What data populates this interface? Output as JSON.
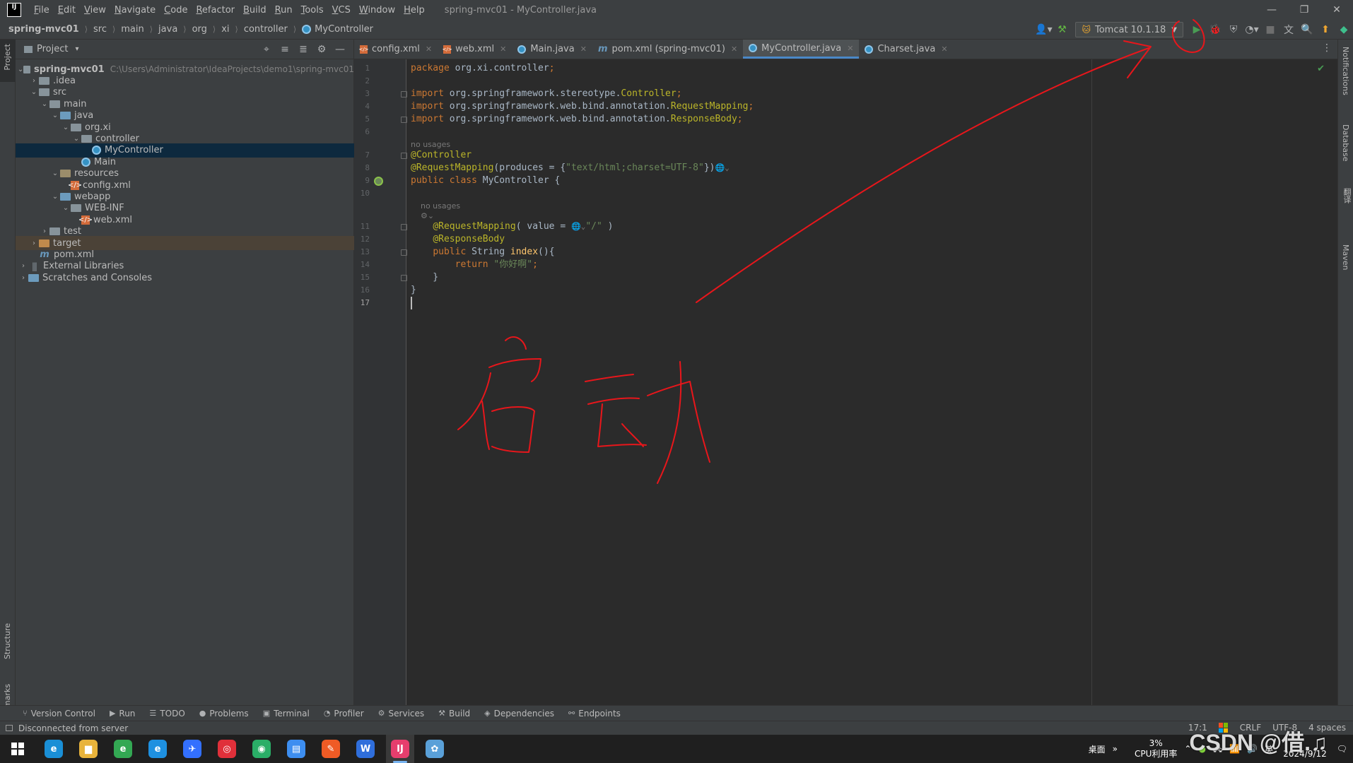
{
  "menubar": {
    "logo": "IJ",
    "items": [
      "File",
      "Edit",
      "View",
      "Navigate",
      "Code",
      "Refactor",
      "Build",
      "Run",
      "Tools",
      "VCS",
      "Window",
      "Help"
    ],
    "window_title": "spring-mvc01 - MyController.java",
    "win_controls": [
      "—",
      "❐",
      "✕"
    ]
  },
  "breadcrumb": [
    "spring-mvc01",
    "src",
    "main",
    "java",
    "org",
    "xi",
    "controller",
    "MyController"
  ],
  "toolbar": {
    "run_config": "Tomcat 10.1.18"
  },
  "left_strip": {
    "project": "Project",
    "structure": "Structure",
    "bookmarks": "Bookmarks"
  },
  "right_strip": {
    "notifications": "Notifications",
    "database": "Database",
    "maven": "Maven",
    "extra": "翻译"
  },
  "project_panel": {
    "title": "Project",
    "tree": [
      {
        "label": "spring-mvc01",
        "path": "C:\\Users\\Administrator\\IdeaProjects\\demo1\\spring-mvc01",
        "indent": 0,
        "arrow": "v",
        "icon": "folder"
      },
      {
        "label": ".idea",
        "indent": 1,
        "arrow": ">",
        "icon": "folder"
      },
      {
        "label": "src",
        "indent": 1,
        "arrow": "v",
        "icon": "folder"
      },
      {
        "label": "main",
        "indent": 2,
        "arrow": "v",
        "icon": "folder"
      },
      {
        "label": "java",
        "indent": 3,
        "arrow": "v",
        "icon": "folder-src"
      },
      {
        "label": "org.xi",
        "indent": 4,
        "arrow": "v",
        "icon": "folder"
      },
      {
        "label": "controller",
        "indent": 5,
        "arrow": "v",
        "icon": "folder"
      },
      {
        "label": "MyController",
        "indent": 6,
        "arrow": "",
        "icon": "class",
        "selected": true
      },
      {
        "label": "Main",
        "indent": 5,
        "arrow": "",
        "icon": "class"
      },
      {
        "label": "resources",
        "indent": 3,
        "arrow": "v",
        "icon": "folder-res"
      },
      {
        "label": "config.xml",
        "indent": 4,
        "arrow": "",
        "icon": "xml"
      },
      {
        "label": "webapp",
        "indent": 3,
        "arrow": "v",
        "icon": "folder-src"
      },
      {
        "label": "WEB-INF",
        "indent": 4,
        "arrow": "v",
        "icon": "folder"
      },
      {
        "label": "web.xml",
        "indent": 5,
        "arrow": "",
        "icon": "xml"
      },
      {
        "label": "test",
        "indent": 2,
        "arrow": ">",
        "icon": "folder"
      },
      {
        "label": "target",
        "indent": 1,
        "arrow": ">",
        "icon": "folder-target",
        "excluded": true
      },
      {
        "label": "pom.xml",
        "indent": 1,
        "arrow": "",
        "icon": "maven"
      },
      {
        "label": "External Libraries",
        "indent": 0,
        "arrow": ">",
        "icon": "lib"
      },
      {
        "label": "Scratches and Consoles",
        "indent": 0,
        "arrow": ">",
        "icon": "scratch"
      }
    ]
  },
  "editor_tabs": [
    {
      "label": "config.xml",
      "icon": "xml"
    },
    {
      "label": "web.xml",
      "icon": "xml"
    },
    {
      "label": "Main.java",
      "icon": "class"
    },
    {
      "label": "pom.xml (spring-mvc01)",
      "icon": "maven"
    },
    {
      "label": "MyController.java",
      "icon": "class",
      "active": true
    },
    {
      "label": "Charset.java",
      "icon": "class"
    }
  ],
  "editor": {
    "lines": [
      {
        "n": "1",
        "t": "code",
        "html": "<span class='kw'>package</span> org.xi.controller<span class='kw'>;</span>"
      },
      {
        "n": "2",
        "t": "code",
        "html": ""
      },
      {
        "n": "3",
        "t": "code",
        "html": "<span class='kw'>import</span> org.springframework.stereotype.<span class='ann'>Controller</span><span class='kw'>;</span>",
        "fold": true
      },
      {
        "n": "4",
        "t": "code",
        "html": "<span class='kw'>import</span> org.springframework.web.bind.annotation.<span class='ann'>RequestMapping</span><span class='kw'>;</span>"
      },
      {
        "n": "5",
        "t": "code",
        "html": "<span class='kw'>import</span> org.springframework.web.bind.annotation.<span class='ann'>ResponseBody</span><span class='kw'>;</span>",
        "fold": true
      },
      {
        "n": "6",
        "t": "code",
        "html": ""
      },
      {
        "n": "",
        "t": "hint",
        "html": "no usages"
      },
      {
        "n": "7",
        "t": "code",
        "html": "<span class='ann'>@Controller</span>",
        "fold": true
      },
      {
        "n": "8",
        "t": "code",
        "html": "<span class='ann'>@RequestMapping</span>(produces = {<span class='str'>\"text/html;charset=UTF-8\"</span>})<span class='ic'>&#x1F310;&#x2304;</span>"
      },
      {
        "n": "9",
        "t": "code",
        "html": "<span class='kw'>public class</span> MyController {",
        "bean": true
      },
      {
        "n": "10",
        "t": "code",
        "html": ""
      },
      {
        "n": "",
        "t": "hint",
        "html": "    no usages"
      },
      {
        "n": "",
        "t": "hint",
        "html": "    &#x2699;&#x2304;"
      },
      {
        "n": "11",
        "t": "code",
        "html": "    <span class='ann'>@RequestMapping</span>( value = <span class='ic'>&#x1F310;&#x2304;</span><span class='str'>\"/\"</span> )",
        "fold": true
      },
      {
        "n": "12",
        "t": "code",
        "html": "    <span class='ann'>@ResponseBody</span>"
      },
      {
        "n": "13",
        "t": "code",
        "html": "    <span class='kw'>public</span> String <span class='fn'>index</span>(){",
        "fold": true
      },
      {
        "n": "14",
        "t": "code",
        "html": "        <span class='kw'>return</span> <span class='str'>\"你好啊\"</span><span class='kw'>;</span>"
      },
      {
        "n": "15",
        "t": "code",
        "html": "    }",
        "fold": true
      },
      {
        "n": "16",
        "t": "code",
        "html": "}"
      },
      {
        "n": "17",
        "t": "code",
        "html": "",
        "current": true
      }
    ],
    "annotation_text": "启动"
  },
  "bottom_tools": [
    {
      "label": "Version Control",
      "icon": "⑂"
    },
    {
      "label": "Run",
      "icon": "▶"
    },
    {
      "label": "TODO",
      "icon": "☰"
    },
    {
      "label": "Problems",
      "icon": "●"
    },
    {
      "label": "Terminal",
      "icon": "▣"
    },
    {
      "label": "Profiler",
      "icon": "◔"
    },
    {
      "label": "Services",
      "icon": "⚙"
    },
    {
      "label": "Build",
      "icon": "⚒"
    },
    {
      "label": "Dependencies",
      "icon": "◈"
    },
    {
      "label": "Endpoints",
      "icon": "⚯"
    }
  ],
  "statusbar": {
    "message": "Disconnected from server",
    "position": "17:1",
    "line_sep": "CRLF",
    "encoding": "UTF-8",
    "indent": "4 spaces"
  },
  "taskbar": {
    "apps": [
      {
        "name": "edge",
        "color": "#1a8fd6",
        "glyph": "e"
      },
      {
        "name": "explorer",
        "color": "#e8b33b",
        "glyph": "▆"
      },
      {
        "name": "browser-green",
        "color": "#33a853",
        "glyph": "e"
      },
      {
        "name": "ie",
        "color": "#1e90e0",
        "glyph": "e"
      },
      {
        "name": "feishu",
        "color": "#3370ff",
        "glyph": "✈"
      },
      {
        "name": "netease-music",
        "color": "#e0303a",
        "glyph": "◎"
      },
      {
        "name": "wechat",
        "color": "#2aae67",
        "glyph": "◉"
      },
      {
        "name": "files",
        "color": "#3d8ef0",
        "glyph": "▤"
      },
      {
        "name": "postman",
        "color": "#ef5b25",
        "glyph": "✎"
      },
      {
        "name": "wps",
        "color": "#2f6edb",
        "glyph": "W"
      },
      {
        "name": "intellij",
        "color": "#e63e6d",
        "glyph": "IJ",
        "active": true
      },
      {
        "name": "paint",
        "color": "#5aa0d8",
        "glyph": "✿"
      }
    ],
    "desktop_label": "桌面",
    "cpu_value": "3%",
    "cpu_label": "CPU利用率",
    "ime": "英",
    "date": "2024/9/12"
  },
  "watermark": "CSDN @借.♫",
  "colors": {
    "accent": "#4a88c7",
    "annotation_red": "#e8161b",
    "run_green": "#499c54"
  }
}
